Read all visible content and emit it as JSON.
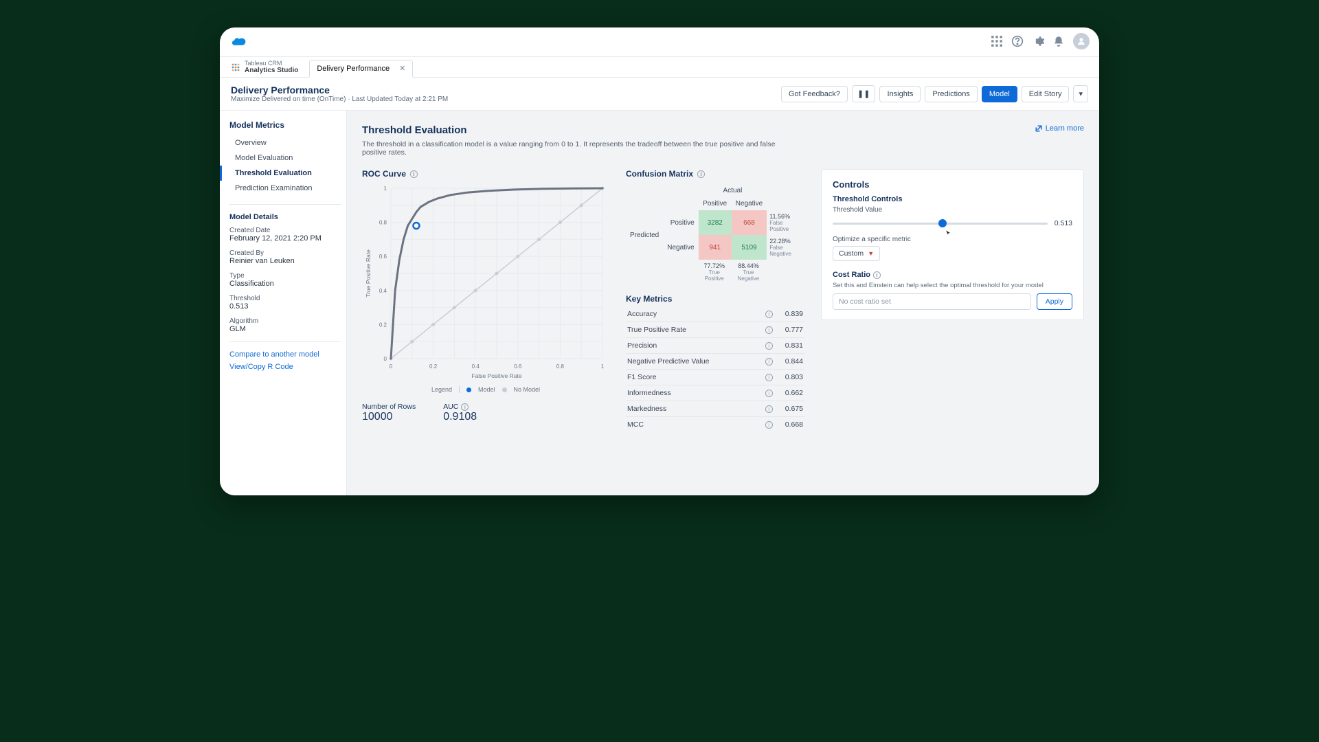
{
  "chart_data": {
    "roc": {
      "type": "line",
      "title": "ROC Curve",
      "xlabel": "False Positive Rate",
      "ylabel": "True Positive Rate",
      "xlim": [
        0,
        1
      ],
      "ylim": [
        0,
        1
      ],
      "ticks": [
        0,
        0.1,
        0.2,
        0.3,
        0.4,
        0.5,
        0.6,
        0.7,
        0.8,
        0.9,
        1
      ],
      "series": [
        {
          "name": "Model",
          "color": "#6b7280",
          "x": [
            0,
            0.02,
            0.04,
            0.06,
            0.08,
            0.1,
            0.12,
            0.14,
            0.18,
            0.22,
            0.28,
            0.36,
            0.46,
            0.58,
            0.72,
            0.86,
            1.0
          ],
          "y": [
            0,
            0.4,
            0.58,
            0.7,
            0.78,
            0.82,
            0.86,
            0.89,
            0.92,
            0.94,
            0.96,
            0.975,
            0.985,
            0.992,
            0.997,
            0.999,
            1.0
          ]
        },
        {
          "name": "No Model",
          "color": "#c9ced6",
          "x": [
            0,
            1
          ],
          "y": [
            0,
            1
          ]
        }
      ],
      "operating_point": {
        "fpr": 0.12,
        "tpr": 0.78
      },
      "legend_label": "Legend"
    }
  },
  "app": {
    "root_tab_l1": "Tableau CRM",
    "root_tab_l2": "Analytics Studio"
  },
  "tab": {
    "title": "Delivery Performance"
  },
  "page": {
    "title": "Delivery Performance",
    "subtitle": "Maximize Delivered on time (OnTime) · Last Updated Today at 2:21 PM"
  },
  "actions": {
    "feedback": "Got Feedback?",
    "insights": "Insights",
    "predictions": "Predictions",
    "model": "Model",
    "edit_story": "Edit Story"
  },
  "sidebar": {
    "heading": "Model Metrics",
    "items": [
      "Overview",
      "Model Evaluation",
      "Threshold Evaluation",
      "Prediction Examination"
    ],
    "active_index": 2,
    "details_heading": "Model Details",
    "details": [
      {
        "k": "Created Date",
        "v": "February 12, 2021 2:20 PM"
      },
      {
        "k": "Created By",
        "v": "Reinier van Leuken"
      },
      {
        "k": "Type",
        "v": "Classification"
      },
      {
        "k": "Threshold",
        "v": "0.513"
      },
      {
        "k": "Algorithm",
        "v": "GLM"
      }
    ],
    "links": [
      "Compare to another model",
      "View/Copy R Code"
    ]
  },
  "main": {
    "title": "Threshold Evaluation",
    "desc": "The threshold in a classification model is a value ranging from 0 to 1. It represents the tradeoff between the true positive and false positive rates.",
    "learn_more": "Learn more"
  },
  "roc": {
    "title": "ROC Curve",
    "rows_label": "Number of Rows",
    "rows_value": "10000",
    "auc_label": "AUC",
    "auc_value": "0.9108"
  },
  "confusion": {
    "title": "Confusion Matrix",
    "actual": "Actual",
    "predicted": "Predicted",
    "positive": "Positive",
    "negative": "Negative",
    "tp": "3282",
    "fn": "668",
    "fp": "941",
    "tn": "5109",
    "fp_rate": "11.56%",
    "fp_label": "False Positive",
    "fn_rate": "22.28%",
    "fn_label": "False Negative",
    "tpr": "77.72%",
    "tpr_label": "True Positive",
    "tnr": "88.44%",
    "tnr_label": "True Negative"
  },
  "key_metrics": {
    "title": "Key Metrics",
    "rows": [
      {
        "k": "Accuracy",
        "v": "0.839"
      },
      {
        "k": "True Positive Rate",
        "v": "0.777"
      },
      {
        "k": "Precision",
        "v": "0.831"
      },
      {
        "k": "Negative Predictive Value",
        "v": "0.844"
      },
      {
        "k": "F1 Score",
        "v": "0.803"
      },
      {
        "k": "Informedness",
        "v": "0.662"
      },
      {
        "k": "Markedness",
        "v": "0.675"
      },
      {
        "k": "MCC",
        "v": "0.668"
      }
    ]
  },
  "controls": {
    "title": "Controls",
    "threshold_heading": "Threshold Controls",
    "threshold_label": "Threshold Value",
    "threshold_value": "0.513",
    "optimize_label": "Optimize a specific metric",
    "optimize_selected": "Custom",
    "cost_heading": "Cost Ratio",
    "cost_desc": "Set this and Einstein can help select the optimal threshold for your model",
    "cost_placeholder": "No cost ratio set",
    "apply": "Apply"
  }
}
